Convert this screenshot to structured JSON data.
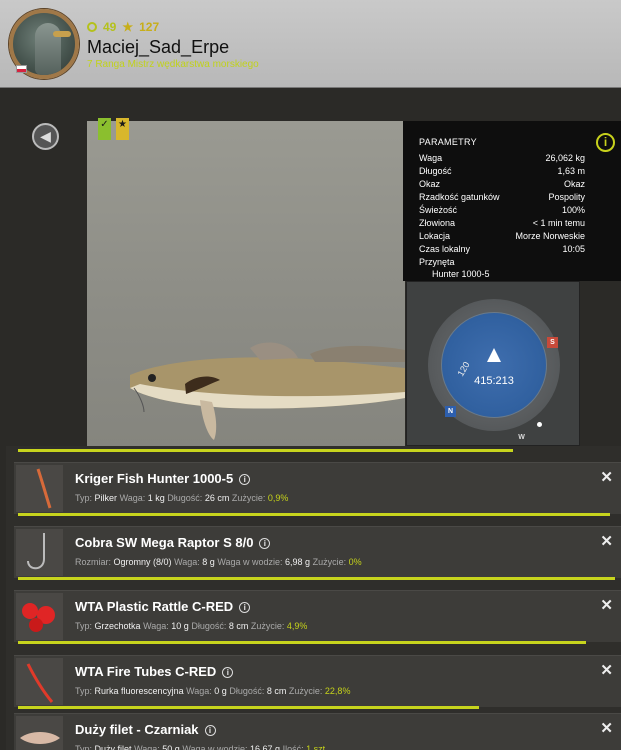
{
  "player": {
    "level": "49",
    "stars": "127",
    "username": "Maciej_Sad_Erpe",
    "rank": "7 Ranga Mistrz wędkarstwa morskiego"
  },
  "icons": {
    "level": "circle-level-icon",
    "stars": "star-icon",
    "back": "back-arrow-icon",
    "info": "info-icon",
    "close": "close-icon"
  },
  "colors": {
    "accent": "#c7d41d",
    "rank_text": "#c1d21b",
    "compass_map": "#30609f"
  },
  "params": {
    "title": "PARAMETRY",
    "rows": [
      {
        "label": "Waga",
        "value": "26,062 kg"
      },
      {
        "label": "Długość",
        "value": "1,63 m"
      },
      {
        "label": "Okaz",
        "value": "Okaz"
      },
      {
        "label": "Rzadkość gatunków",
        "value": "Pospolity"
      },
      {
        "label": "Świeżość",
        "value": "100%"
      },
      {
        "label": "Złowiona",
        "value": "< 1 min temu"
      },
      {
        "label": "Lokacja",
        "value": "Morze Norweskie"
      },
      {
        "label": "Czas lokalny",
        "value": "10:05"
      },
      {
        "label": "Przynęta",
        "value": ""
      }
    ],
    "bait": "Hunter 1000-5"
  },
  "compass": {
    "coords": "415:213",
    "heading": "120",
    "dir_s": "S",
    "dir_n": "N",
    "dir_w": "W"
  },
  "tackle": [
    {
      "name": "Kriger Fish Hunter 1000-5",
      "detail_label_1": "Typ:",
      "detail_value_1": "Pilker",
      "detail_label_2": "Waga:",
      "detail_value_2": "1 kg",
      "detail_label_3": "Długość:",
      "detail_value_3": "26 cm",
      "wear_label": "Zużycie:",
      "wear_value": "0,9%",
      "condition": 0.991
    },
    {
      "name": "Cobra SW Mega Raptor S 8/0",
      "detail_label_1": "Rozmiar:",
      "detail_value_1": "Ogromny (8/0)",
      "detail_label_2": "Waga:",
      "detail_value_2": "8 g",
      "detail_label_3": "Waga w wodzie:",
      "detail_value_3": "6,98 g",
      "wear_label": "Zużycie:",
      "wear_value": "0%",
      "condition": 1.0
    },
    {
      "name": "WTA Plastic Rattle C-RED",
      "detail_label_1": "Typ:",
      "detail_value_1": "Grzechotka",
      "detail_label_2": "Waga:",
      "detail_value_2": "10 g",
      "detail_label_3": "Długość:",
      "detail_value_3": "8 cm",
      "wear_label": "Zużycie:",
      "wear_value": "4,9%",
      "condition": 0.951
    },
    {
      "name": "WTA Fire Tubes C-RED",
      "detail_label_1": "Typ:",
      "detail_value_1": "Rurka fluorescencyjna",
      "detail_label_2": "Waga:",
      "detail_value_2": "0 g",
      "detail_label_3": "Długość:",
      "detail_value_3": "8 cm",
      "wear_label": "Zużycie:",
      "wear_value": "22,8%",
      "condition": 0.772
    },
    {
      "name": "Duży filet - Czarniak",
      "detail_label_1": "Typ:",
      "detail_value_1": "Duży filet",
      "detail_label_2": "Waga:",
      "detail_value_2": "50 g",
      "detail_label_3": "Waga w wodzie:",
      "detail_value_3": "16,67 g",
      "wear_label": "Ilość:",
      "wear_value": "1 szt",
      "condition": 1.0
    }
  ]
}
